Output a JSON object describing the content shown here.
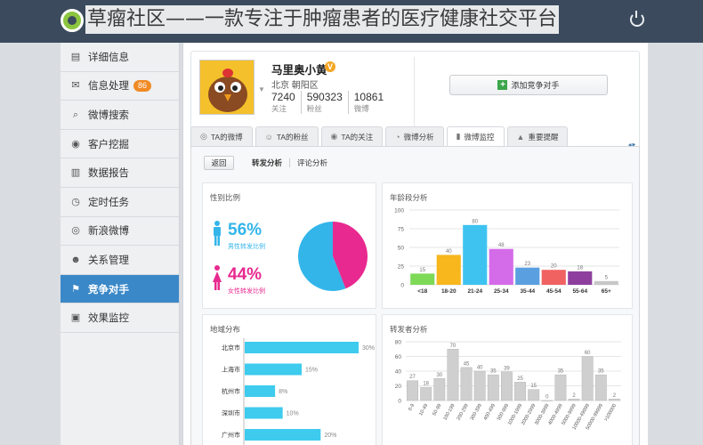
{
  "header": {
    "title": "草瘤社区——一款专注于肿瘤患者的医疗健康社交平台"
  },
  "sidebar": {
    "items": [
      {
        "label": "详细信息",
        "icon": "document-icon"
      },
      {
        "label": "信息处理",
        "icon": "mail-icon",
        "badge": "86"
      },
      {
        "label": "微博搜索",
        "icon": "search-icon"
      },
      {
        "label": "客户挖掘",
        "icon": "target-icon"
      },
      {
        "label": "数据报告",
        "icon": "report-icon"
      },
      {
        "label": "定时任务",
        "icon": "clock-icon"
      },
      {
        "label": "新浪微博",
        "icon": "weibo-icon"
      },
      {
        "label": "关系管理",
        "icon": "people-icon"
      },
      {
        "label": "竞争对手",
        "icon": "competitor-icon",
        "active": true
      },
      {
        "label": "效果监控",
        "icon": "monitor-icon"
      }
    ]
  },
  "profile": {
    "name": "马里奥小黄",
    "verified": "V",
    "location": "北京 朝阳区",
    "stats": [
      {
        "value": "7240",
        "label": "关注"
      },
      {
        "value": "590323",
        "label": "粉丝"
      },
      {
        "value": "10861",
        "label": "微博"
      }
    ],
    "add_button": "添加竞争对手"
  },
  "tabs": [
    {
      "label": "TA的微博",
      "icon": "weibo-icon"
    },
    {
      "label": "TA的粉丝",
      "icon": "fans-icon"
    },
    {
      "label": "TA的关注",
      "icon": "eye-icon"
    },
    {
      "label": "微博分析",
      "icon": "analysis-icon"
    },
    {
      "label": "微博监控",
      "icon": "bar-chart-icon",
      "active": true
    },
    {
      "label": "重要提醒",
      "icon": "alert-icon"
    }
  ],
  "subtabs": {
    "back": "返回",
    "items": [
      "转发分析",
      "评论分析"
    ]
  },
  "cards": {
    "gender_title": "性别比例",
    "age_title": "年龄段分析",
    "region_title": "地域分布",
    "forwarder_title": "转发者分析"
  },
  "colors": {
    "male": "#33b5ea",
    "female": "#e8298f",
    "accent": "#3a88c8",
    "badge": "#f08a24"
  },
  "chart_data": [
    {
      "type": "pie",
      "title": "性别比例",
      "slices": [
        {
          "name": "男性转发比例",
          "value": 56,
          "label": "56%",
          "color": "#33b5ea"
        },
        {
          "name": "女性转发比例",
          "value": 44,
          "label": "44%",
          "color": "#e8298f"
        }
      ]
    },
    {
      "type": "bar",
      "title": "年龄段分析",
      "categories": [
        "<18",
        "18-20",
        "21-24",
        "25-34",
        "35-44",
        "45-54",
        "55-64",
        "65+"
      ],
      "values": [
        15,
        40,
        80,
        48,
        23,
        20,
        18,
        5
      ],
      "colors": [
        "#7ed957",
        "#f7b71d",
        "#3ec3f0",
        "#d46be8",
        "#5aa0e0",
        "#f06262",
        "#8e3f9e",
        "#c7c7c7"
      ],
      "ylim": [
        0,
        100
      ],
      "yticks": [
        0,
        25,
        50,
        75,
        100
      ]
    },
    {
      "type": "bar",
      "orientation": "horizontal",
      "title": "地域分布",
      "categories": [
        "北京市",
        "上海市",
        "杭州市",
        "深圳市",
        "广州市"
      ],
      "values": [
        30,
        15,
        8,
        10,
        20
      ],
      "labels": [
        "30%",
        "15%",
        "8%",
        "10%",
        "20%"
      ],
      "xlim": [
        0,
        30
      ]
    },
    {
      "type": "bar",
      "title": "转发者分析",
      "categories": [
        "0-9",
        "10-49",
        "50-99",
        "100-199",
        "200-299",
        "300-399",
        "400-499",
        "500-999",
        "1000-1999",
        "2000-2999",
        "3000-3999",
        "4000-4999",
        "5000-9999",
        "10000-49999",
        "50000-99999",
        ">100000"
      ],
      "values": [
        27,
        18,
        30,
        70,
        45,
        40,
        35,
        39,
        25,
        15,
        0,
        35,
        2,
        60,
        35,
        2
      ],
      "ylim": [
        0,
        80
      ],
      "yticks": [
        0,
        20,
        40,
        60,
        80
      ]
    }
  ]
}
